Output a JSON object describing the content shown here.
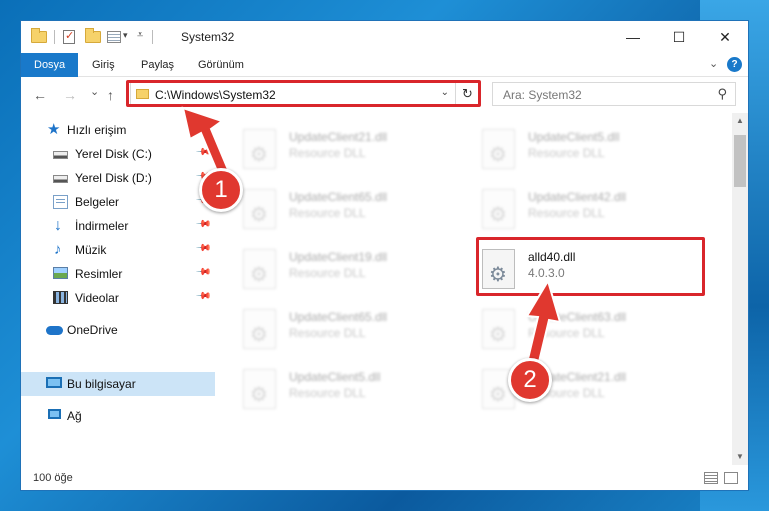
{
  "window": {
    "title": "System32",
    "controls": {
      "minimize": "—",
      "maximize": "☐",
      "close": "✕"
    }
  },
  "ribbon": {
    "tabs": [
      {
        "label": "Dosya",
        "active": true
      },
      {
        "label": "Giriş"
      },
      {
        "label": "Paylaş"
      },
      {
        "label": "Görünüm"
      }
    ],
    "expand_icon": "chevron-down-icon",
    "help_icon": "help-icon"
  },
  "navigation": {
    "back": "←",
    "forward": "→",
    "recent": "⌄",
    "up": "↑",
    "address": "C:\\Windows\\System32",
    "refresh": "↻",
    "search_placeholder": "Ara: System32"
  },
  "sidebar": {
    "items": [
      {
        "label": "Hızlı erişim",
        "icon": "star-icon"
      },
      {
        "label": "Yerel Disk (C:)",
        "icon": "disk-icon",
        "pinned": true
      },
      {
        "label": "Yerel Disk (D:)",
        "icon": "disk-icon",
        "pinned": true
      },
      {
        "label": "Belgeler",
        "icon": "documents-icon",
        "pinned": true
      },
      {
        "label": "İndirmeler",
        "icon": "downloads-icon",
        "pinned": true
      },
      {
        "label": "Müzik",
        "icon": "music-icon",
        "pinned": true
      },
      {
        "label": "Resimler",
        "icon": "pictures-icon",
        "pinned": true
      },
      {
        "label": "Videolar",
        "icon": "videos-icon",
        "pinned": true
      },
      {
        "label": "OneDrive",
        "icon": "onedrive-icon"
      },
      {
        "label": "Bu bilgisayar",
        "icon": "this-pc-icon",
        "selected": true
      },
      {
        "label": "Ağ",
        "icon": "network-icon"
      }
    ]
  },
  "files": [
    {
      "name": "UpdateClient21.dll",
      "desc": "Resource DLL",
      "blurred": true
    },
    {
      "name": "UpdateClient5.dll",
      "desc": "Resource DLL",
      "blurred": true
    },
    {
      "name": "UpdateClient65.dll",
      "desc": "Resource DLL",
      "blurred": true
    },
    {
      "name": "UpdateClient42.dll",
      "desc": "Resource DLL",
      "blurred": true
    },
    {
      "name": "UpdateClient19.dll",
      "desc": "Resource DLL",
      "blurred": true
    },
    {
      "name": "alld40.dll",
      "desc": "4.0.3.0",
      "blurred": false
    },
    {
      "name": "UpdateClient65.dll",
      "desc": "Resource DLL",
      "blurred": true
    },
    {
      "name": "UpdateClient63.dll",
      "desc": "Resource DLL",
      "blurred": true
    },
    {
      "name": "UpdateClient5.dll",
      "desc": "Resource DLL",
      "blurred": true
    },
    {
      "name": "UpdateClient21.dll",
      "desc": "Resource DLL",
      "blurred": true
    }
  ],
  "status": {
    "item_count": "100 öğe"
  },
  "annotations": [
    {
      "number": "1",
      "color": "#d9262b"
    },
    {
      "number": "2",
      "color": "#d9262b"
    }
  ]
}
